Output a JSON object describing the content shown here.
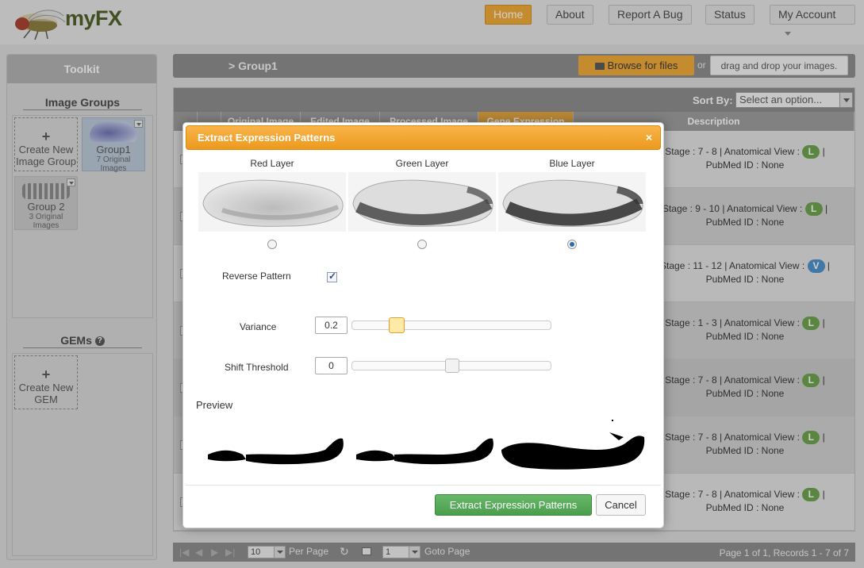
{
  "app": {
    "logo_text": "myFX"
  },
  "nav": {
    "home": "Home",
    "about": "About",
    "report_bug": "Report A Bug",
    "status": "Status",
    "account": "My Account"
  },
  "toolkit": {
    "title": "Toolkit",
    "image_groups": {
      "title": "Image Groups",
      "create_line1": "Create New",
      "create_line2": "Image Group",
      "groups": [
        {
          "name": "Group1",
          "count": "7 Original Images"
        },
        {
          "name": "Group 2",
          "count": "3 Original Images"
        }
      ]
    },
    "gems": {
      "title": "GEMs",
      "help_icon": "?",
      "create_line1": "Create New",
      "create_line2": "GEM"
    }
  },
  "main": {
    "breadcrumb": "> Group1",
    "browse_label": "Browse for files",
    "or_label": "or",
    "drag_label": "drag and drop your images.",
    "sort_label": "Sort By:",
    "sort_placeholder": "Select an option...",
    "columns": [
      "Original Image",
      "Edited Image",
      "Processed Image",
      "Gene Expression",
      "Description"
    ],
    "rows": [
      {
        "stage": "Stage : 7 - 8 | Anatomical View :",
        "view": "L",
        "pubmed": "PubMed ID : None"
      },
      {
        "stage": "Stage : 9 - 10 | Anatomical View :",
        "view": "L",
        "pubmed": "PubMed ID : None"
      },
      {
        "stage": "Stage : 11 - 12 | Anatomical View :",
        "view": "V",
        "pubmed": "PubMed ID : None"
      },
      {
        "stage": "Stage : 1 - 3 | Anatomical View :",
        "view": "L",
        "pubmed": "PubMed ID : None"
      },
      {
        "stage": "Stage : 7 - 8 | Anatomical View :",
        "view": "L",
        "pubmed": "PubMed ID : None"
      },
      {
        "stage": "Stage : 7 - 8 | Anatomical View :",
        "view": "L",
        "pubmed": "PubMed ID : None"
      },
      {
        "stage": "Stage : 7 - 8 | Anatomical View :",
        "view": "L",
        "pubmed": "PubMed ID : None"
      }
    ],
    "pager": {
      "per_page_value": "10",
      "per_page_label": "Per Page",
      "page_value": "1",
      "goto_label": "Goto Page",
      "summary": "Page 1 of 1, Records 1 - 7 of 7"
    }
  },
  "dialog": {
    "title": "Extract Expression Patterns",
    "close_label": "×",
    "layers": [
      {
        "label": "Red Layer",
        "selected": false
      },
      {
        "label": "Green Layer",
        "selected": false
      },
      {
        "label": "Blue Layer",
        "selected": true
      }
    ],
    "reverse_label": "Reverse Pattern",
    "reverse_checked": true,
    "variance_label": "Variance",
    "variance_value": "0.2",
    "shift_label": "Shift Threshold",
    "shift_value": "0",
    "preview_label": "Preview",
    "extract_button": "Extract Expression Patterns",
    "cancel_button": "Cancel"
  },
  "colors": {
    "accent": "#f0a830",
    "primary_green": "#4a9e4c",
    "badge_lateral": "#6aa04a",
    "badge_ventral": "#4a8fc8"
  }
}
